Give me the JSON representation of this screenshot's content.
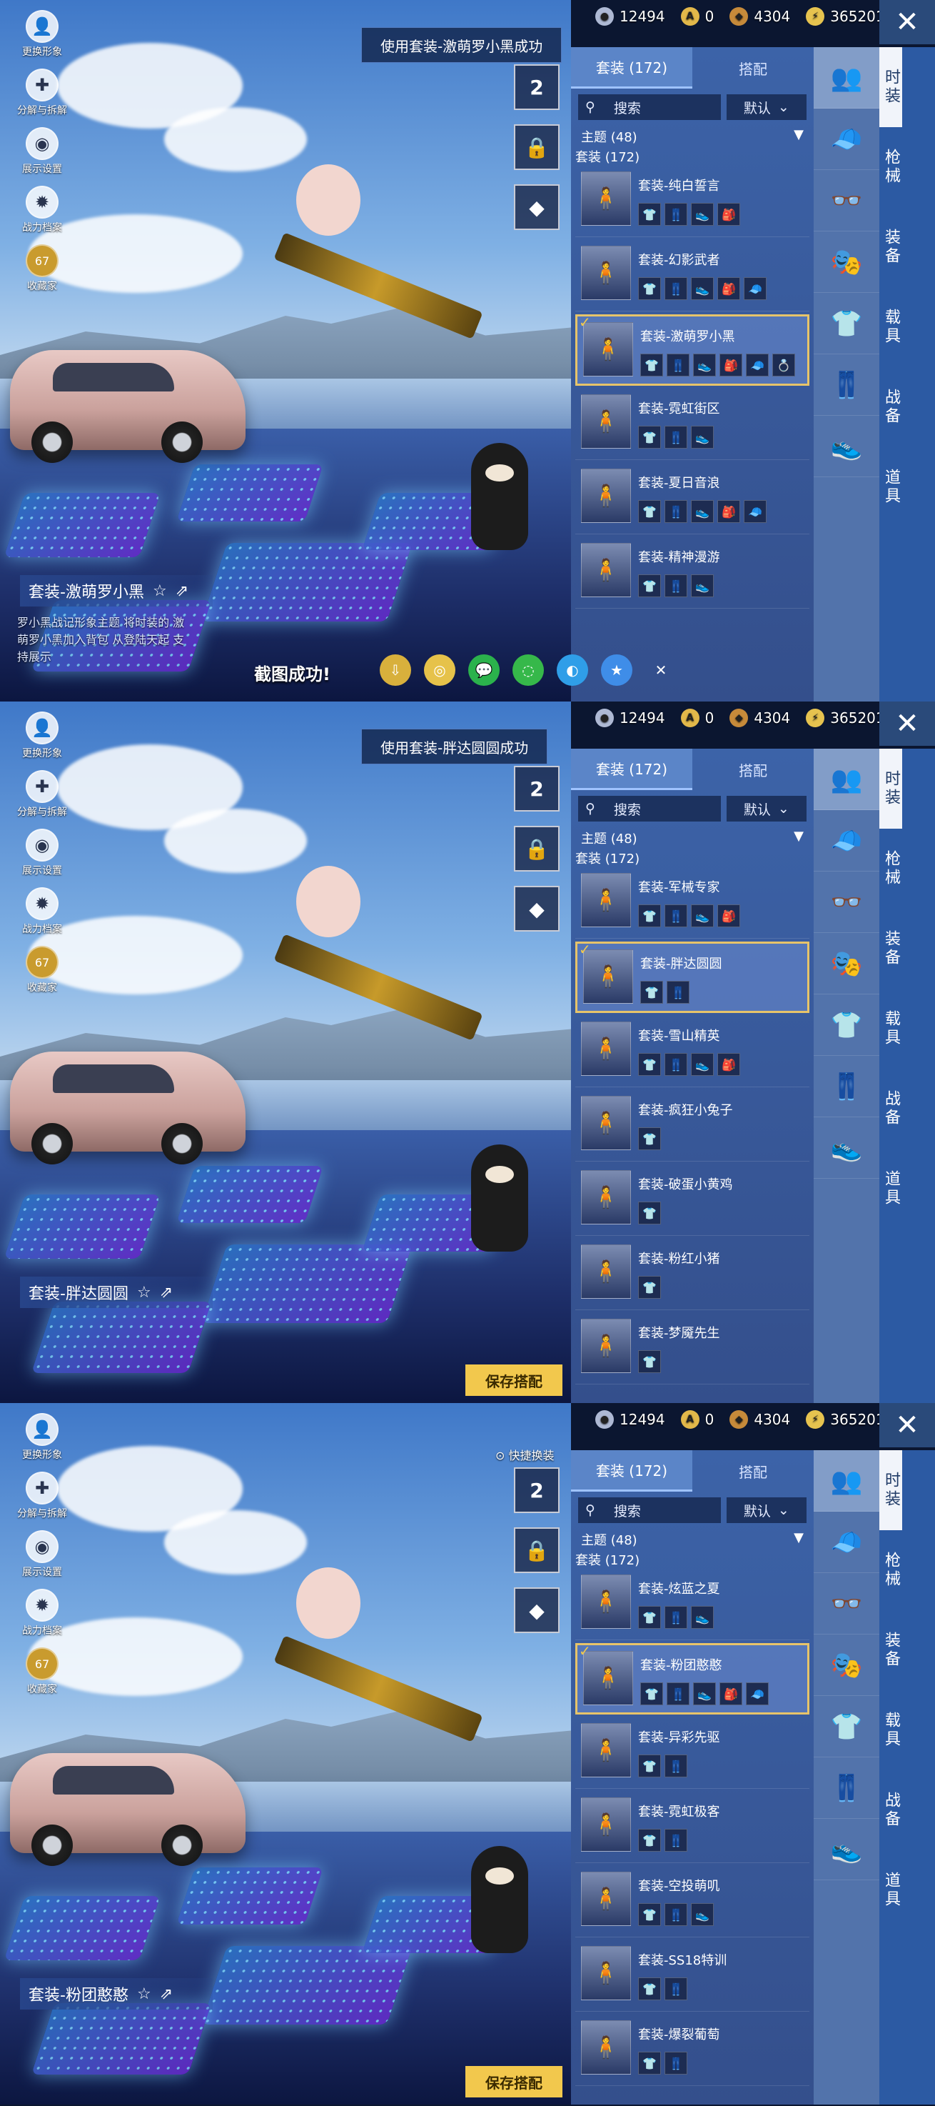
{
  "currency": {
    "item1": "12494",
    "item2": "0",
    "item3": "4304",
    "item4": "365201"
  },
  "left_menu": [
    {
      "label": "更换形象",
      "icon": "person-icon"
    },
    {
      "label": "分解与拆解",
      "icon": "puzzle-icon"
    },
    {
      "label": "展示设置",
      "icon": "eye-icon"
    },
    {
      "label": "战力档案",
      "icon": "flame-icon"
    },
    {
      "label": "收藏家",
      "icon": "badge-icon",
      "badge": "67"
    }
  ],
  "util": {
    "hanger_count": "2"
  },
  "tabs": {
    "outfits": "套装 (172)",
    "match": "搭配"
  },
  "search": {
    "label": "搜索",
    "sort": "默认"
  },
  "filter": {
    "theme": "主题 (48)",
    "outfit": "套装 (172)"
  },
  "categories": [
    "时装",
    "枪械",
    "装备",
    "载具",
    "战备",
    "道具"
  ],
  "panels": [
    {
      "toast": "使用套装-激萌罗小黑成功",
      "outfit_title": "套装-激萌罗小黑",
      "outfit_desc": "罗小黑战记形象主题 将时装的 激萌罗小黑加入背包 从登陆天起 支持展示",
      "screenshot_toast": "截图成功!",
      "items": [
        {
          "name": "套装-纯白誓言",
          "parts": 4,
          "selected": false
        },
        {
          "name": "套装-幻影武者",
          "parts": 5,
          "selected": false
        },
        {
          "name": "套装-激萌罗小黑",
          "parts": 6,
          "selected": true
        },
        {
          "name": "套装-霓虹街区",
          "parts": 3,
          "selected": false
        },
        {
          "name": "套装-夏日音浪",
          "parts": 5,
          "selected": false
        },
        {
          "name": "套装-精神漫游",
          "parts": 3,
          "selected": false
        }
      ]
    },
    {
      "toast": "使用套装-胖达圆圆成功",
      "outfit_title": "套装-胖达圆圆",
      "save_label": "保存搭配",
      "items": [
        {
          "name": "套装-军械专家",
          "parts": 4,
          "selected": false
        },
        {
          "name": "套装-胖达圆圆",
          "parts": 2,
          "selected": true
        },
        {
          "name": "套装-雪山精英",
          "parts": 4,
          "selected": false
        },
        {
          "name": "套装-疯狂小兔子",
          "parts": 1,
          "selected": false
        },
        {
          "name": "套装-破蛋小黄鸡",
          "parts": 1,
          "selected": false
        },
        {
          "name": "套装-粉红小猪",
          "parts": 1,
          "selected": false
        },
        {
          "name": "套装-梦魇先生",
          "parts": 1,
          "selected": false
        }
      ]
    },
    {
      "quick_swap": "快捷换装",
      "outfit_title": "套装-粉团憨憨",
      "save_label": "保存搭配",
      "items": [
        {
          "name": "套装-炫蓝之夏",
          "parts": 3,
          "selected": false
        },
        {
          "name": "套装-粉团憨憨",
          "parts": 5,
          "selected": true
        },
        {
          "name": "套装-异彩先驱",
          "parts": 2,
          "selected": false
        },
        {
          "name": "套装-霓虹极客",
          "parts": 2,
          "selected": false
        },
        {
          "name": "套装-空投萌叽",
          "parts": 3,
          "selected": false
        },
        {
          "name": "套装-SS18特训",
          "parts": 2,
          "selected": false
        },
        {
          "name": "套装-爆裂葡萄",
          "parts": 2,
          "selected": false
        }
      ]
    }
  ],
  "colors": {
    "accent": "#f2c84d",
    "panel": "#3c63a8",
    "cat_active": "#f1f4fa"
  }
}
